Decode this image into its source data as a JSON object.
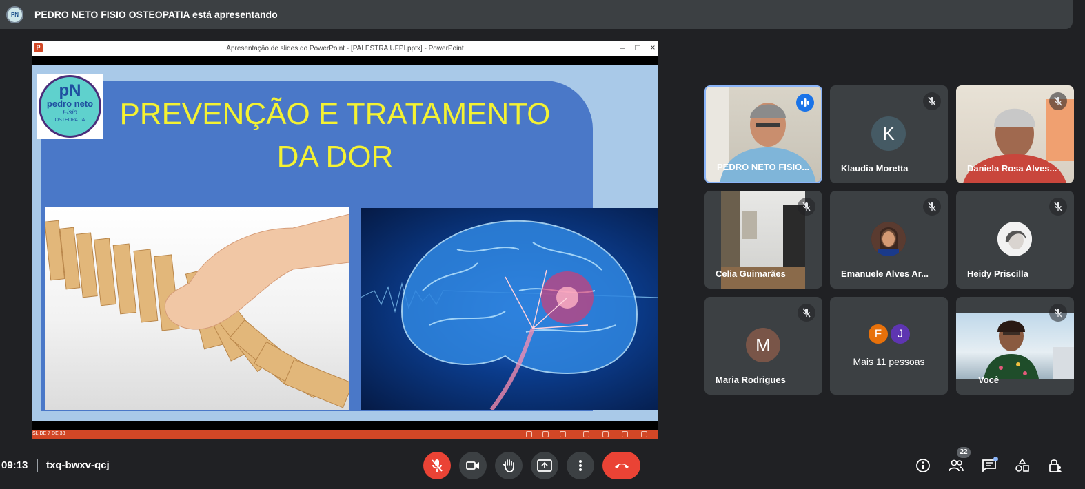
{
  "presenting_bar": {
    "avatar_text": "PN",
    "text": "PEDRO NETO FISIO OSTEOPATIA está apresentando"
  },
  "powerpoint": {
    "window_title": "Apresentação de slides do PowerPoint - [PALESTRA UFPI.pptx] - PowerPoint",
    "app_icon_letter": "P",
    "window_controls": [
      "–",
      "□",
      "×"
    ],
    "status_text": "SLIDE 7 DE 33"
  },
  "slide": {
    "title_line1": "PREVENÇÃO E TRATAMENTO",
    "title_line2": "DA DOR",
    "logo": {
      "mark": "pN",
      "name": "pedro neto",
      "fisio": "Fisio",
      "sub": "OSTEOPATIA"
    },
    "colors": {
      "title": "#f4f232",
      "panel": "#4a78c8",
      "background": "#a9c9e8"
    }
  },
  "participants": [
    {
      "name": "PEDRO NETO FISIO...",
      "speaking": true,
      "type": "video"
    },
    {
      "name": "Klaudia Moretta",
      "muted": true,
      "type": "letter",
      "letter": "K",
      "color": "#455a64"
    },
    {
      "name": "Daniela Rosa Alves...",
      "muted": true,
      "type": "video"
    },
    {
      "name": "Celia Guimarães",
      "muted": true,
      "type": "video"
    },
    {
      "name": "Emanuele Alves Ar...",
      "muted": true,
      "type": "photo"
    },
    {
      "name": "Heidy Priscilla",
      "muted": true,
      "type": "photo"
    },
    {
      "name": "Maria Rodrigues",
      "muted": true,
      "type": "letter",
      "letter": "M",
      "color": "#795548"
    },
    {
      "name": "Mais 11 pessoas",
      "type": "more",
      "letters": [
        "F",
        "J"
      ],
      "colors": [
        "#e8710a",
        "#5e35b1"
      ]
    },
    {
      "name": "Você",
      "muted": true,
      "type": "video"
    }
  ],
  "meeting": {
    "time": "09:13",
    "code": "txq-bwxv-qcj",
    "people_count": "22"
  },
  "controls": {
    "mic": "mic-off-icon",
    "camera": "camera-icon",
    "raise_hand": "hand-icon",
    "present": "present-icon",
    "more": "more-vert-icon",
    "leave": "call-end-icon",
    "danger_color": "#ea4335"
  }
}
